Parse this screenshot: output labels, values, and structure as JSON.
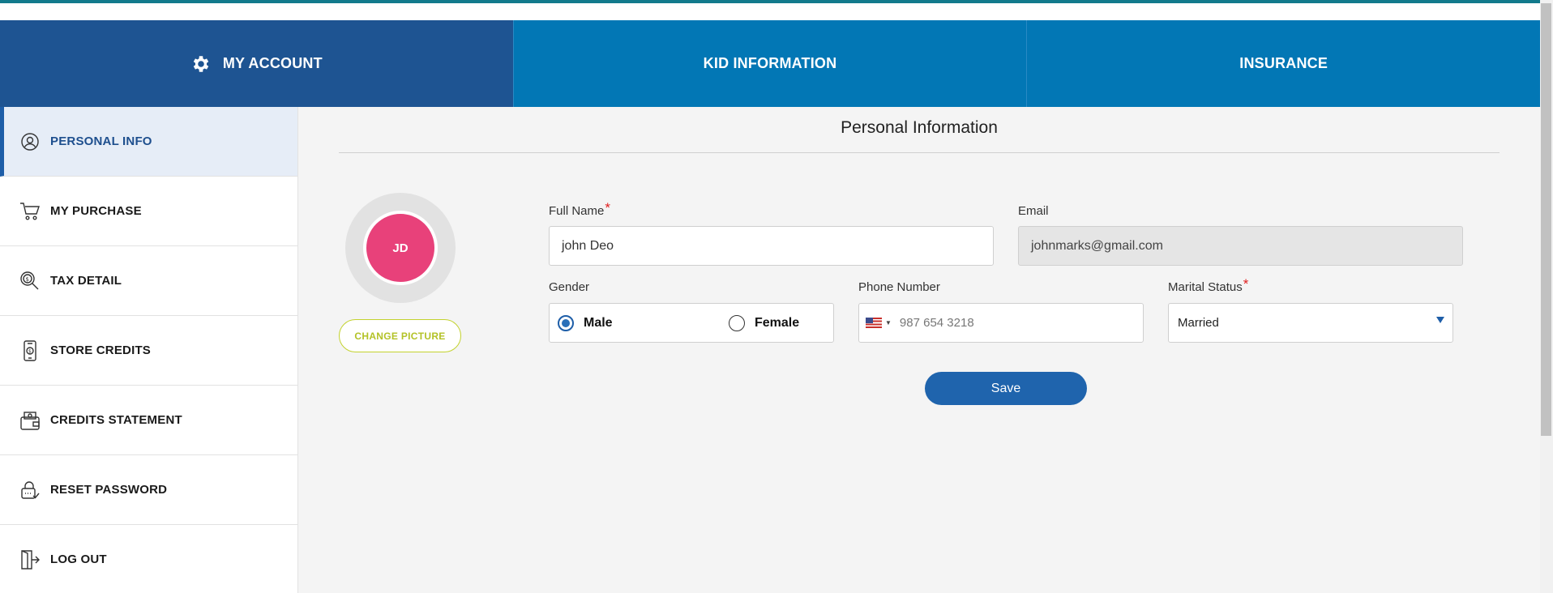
{
  "topnav": {
    "tabs": [
      {
        "label": "MY ACCOUNT",
        "icon": "gear-icon",
        "active": true
      },
      {
        "label": "KID INFORMATION"
      },
      {
        "label": "INSURANCE"
      }
    ]
  },
  "sidebar": {
    "items": [
      {
        "label": "PERSONAL INFO",
        "icon": "user-circle-icon",
        "active": true
      },
      {
        "label": "MY PURCHASE",
        "icon": "cart-icon"
      },
      {
        "label": "TAX DETAIL",
        "icon": "tax-search-icon"
      },
      {
        "label": "STORE CREDITS",
        "icon": "mobile-credit-icon"
      },
      {
        "label": "CREDITS STATEMENT",
        "icon": "wallet-icon"
      },
      {
        "label": "RESET PASSWORD",
        "icon": "lock-reset-icon"
      },
      {
        "label": "LOG OUT",
        "icon": "logout-door-icon"
      }
    ]
  },
  "main": {
    "title": "Personal Information",
    "avatar": {
      "initials": "JD",
      "color": "#e8417a"
    },
    "change_picture_label": "CHANGE PICTURE",
    "form": {
      "full_name": {
        "label": "Full Name",
        "required_mark": "*",
        "value": "john Deo"
      },
      "email": {
        "label": "Email",
        "value": "johnmarks@gmail.com",
        "disabled": true
      },
      "gender": {
        "label": "Gender",
        "options": [
          "Male",
          "Female"
        ],
        "selected": "Male"
      },
      "phone": {
        "label": "Phone Number",
        "country": "US",
        "placeholder": "987 654 3218"
      },
      "marital_status": {
        "label": "Marital Status",
        "required_mark": "*",
        "value": "Married"
      }
    },
    "save_label": "Save"
  },
  "colors": {
    "nav_active": "#1e5492",
    "nav_bg": "#0277b5",
    "accent": "#1f64ad",
    "lime": "#c3d22e"
  }
}
